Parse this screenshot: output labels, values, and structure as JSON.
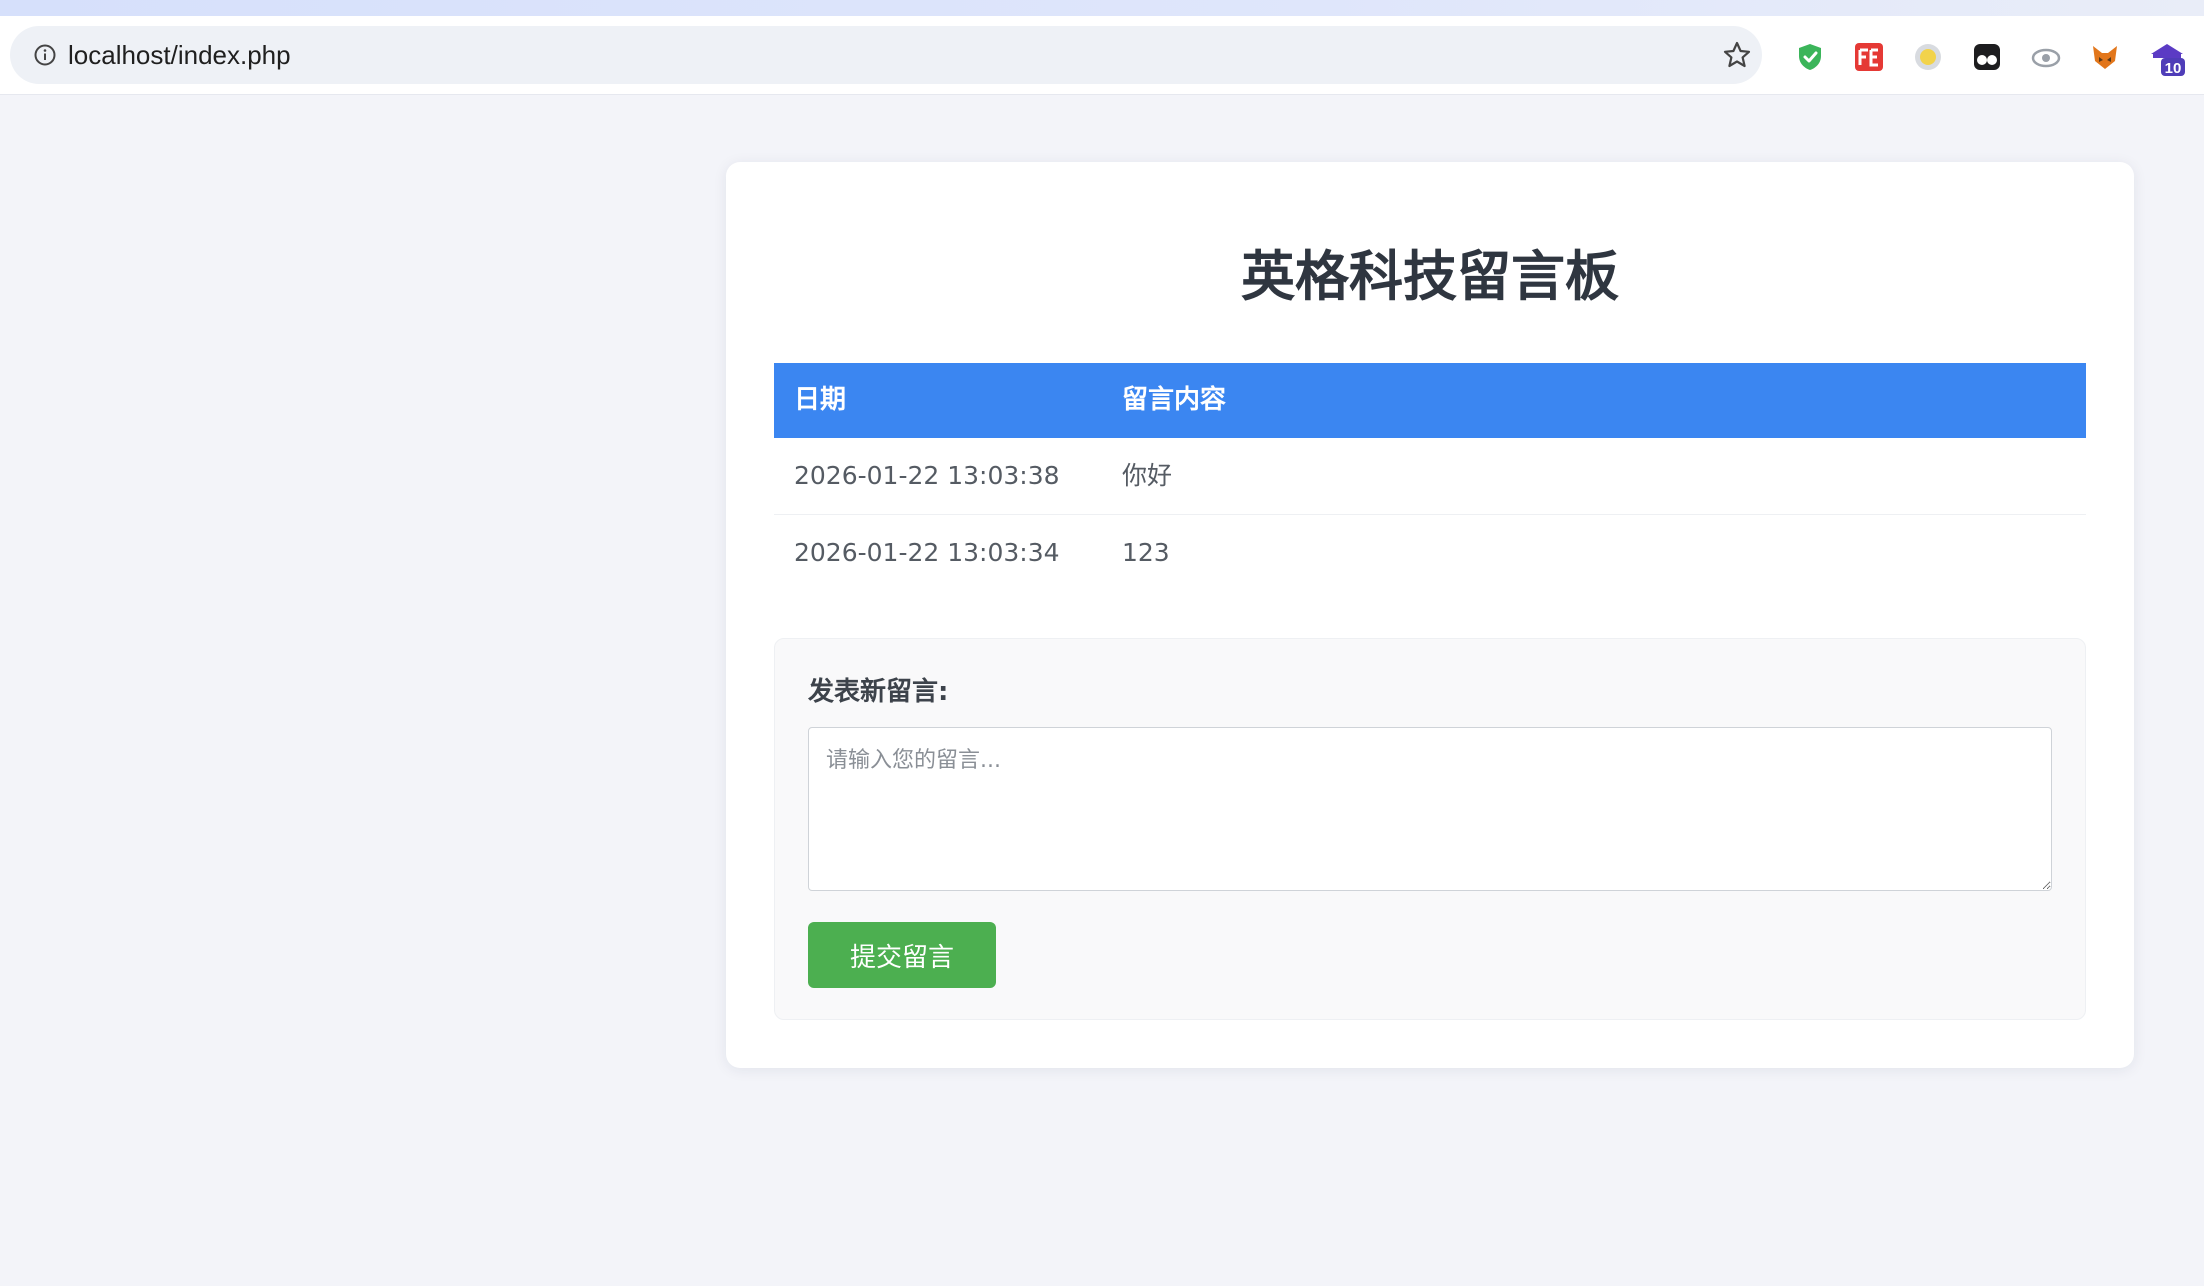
{
  "browser": {
    "url": "localhost/index.php",
    "extension_badge": "10"
  },
  "page": {
    "title": "英格科技留言板",
    "table": {
      "headers": [
        "日期",
        "留言内容"
      ],
      "rows": [
        {
          "date": "2026-01-22 13:03:38",
          "content": "你好"
        },
        {
          "date": "2026-01-22 13:03:34",
          "content": "123"
        }
      ]
    },
    "form": {
      "label": "发表新留言:",
      "placeholder": "请输入您的留言...",
      "submit_label": "提交留言"
    }
  },
  "colors": {
    "table_header": "#3b86f1",
    "submit_button": "#4caf50",
    "page_background": "#f3f4f9"
  }
}
